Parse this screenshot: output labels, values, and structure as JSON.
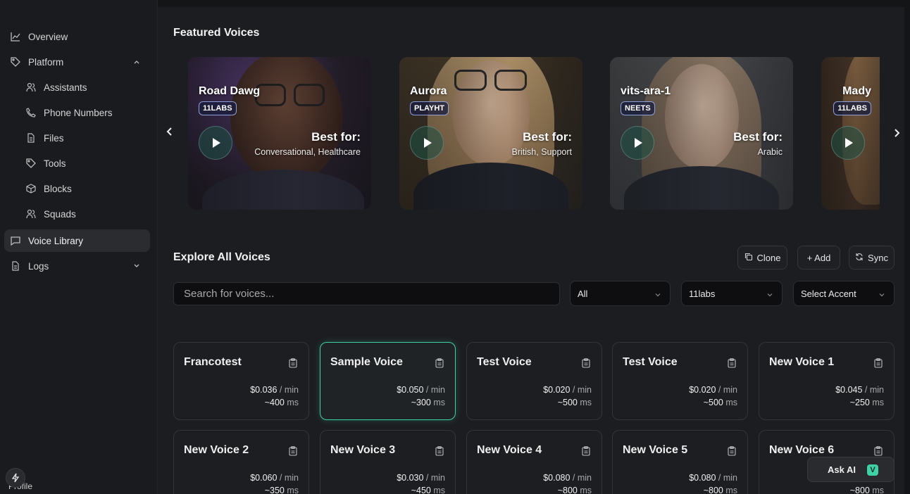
{
  "sidebar": {
    "items": [
      {
        "label": "Overview",
        "icon": "chart-line-icon"
      },
      {
        "label": "Platform",
        "icon": "tag-icon"
      },
      {
        "label": "Assistants",
        "icon": "users-icon"
      },
      {
        "label": "Phone Numbers",
        "icon": "phone-icon"
      },
      {
        "label": "Files",
        "icon": "file-icon"
      },
      {
        "label": "Tools",
        "icon": "tool-icon"
      },
      {
        "label": "Blocks",
        "icon": "cube-icon"
      },
      {
        "label": "Squads",
        "icon": "squad-icon"
      },
      {
        "label": "Voice Library",
        "icon": "chat-icon"
      },
      {
        "label": "Logs",
        "icon": "log-icon"
      }
    ],
    "profile_label": "Profile"
  },
  "featured": {
    "title": "Featured Voices",
    "best_for_label": "Best for:",
    "cards": [
      {
        "name": "Road Dawg",
        "provider": "11LABS",
        "tags": "Conversational, Healthcare"
      },
      {
        "name": "Aurora",
        "provider": "PLAYHT",
        "tags": "British, Support"
      },
      {
        "name": "vits-ara-1",
        "provider": "NEETS",
        "tags": "Arabic"
      },
      {
        "name": "Mady",
        "provider": "11LABS",
        "tags": ""
      }
    ]
  },
  "explore": {
    "title": "Explore All Voices",
    "clone_label": "Clone",
    "add_label": "+ Add",
    "sync_label": "Sync",
    "search_placeholder": "Search for voices...",
    "filter_gender": "All",
    "filter_provider": "11labs",
    "filter_accent": "Select Accent",
    "per_min": "/ min",
    "ms_unit": "ms",
    "voices": [
      {
        "name": "Francotest",
        "price": "$0.036",
        "latency": "~400"
      },
      {
        "name": "Sample Voice",
        "price": "$0.050",
        "latency": "~300"
      },
      {
        "name": "Test Voice",
        "price": "$0.020",
        "latency": "~500"
      },
      {
        "name": "Test Voice",
        "price": "$0.020",
        "latency": "~500"
      },
      {
        "name": "New Voice 1",
        "price": "$0.045",
        "latency": "~250"
      },
      {
        "name": "New Voice 2",
        "price": "$0.060",
        "latency": "~350"
      },
      {
        "name": "New Voice 3",
        "price": "$0.030",
        "latency": "~450"
      },
      {
        "name": "New Voice 4",
        "price": "$0.080",
        "latency": "~800"
      },
      {
        "name": "New Voice 5",
        "price": "$0.080",
        "latency": "~800"
      },
      {
        "name": "New Voice 6",
        "price": "",
        "latency": "~800"
      }
    ]
  },
  "ask_ai": {
    "label": "Ask AI",
    "logo": "V"
  },
  "colors": {
    "accent": "#3fd1a6",
    "background": "#1c1d20",
    "sidebar": "#1a1b1e"
  }
}
